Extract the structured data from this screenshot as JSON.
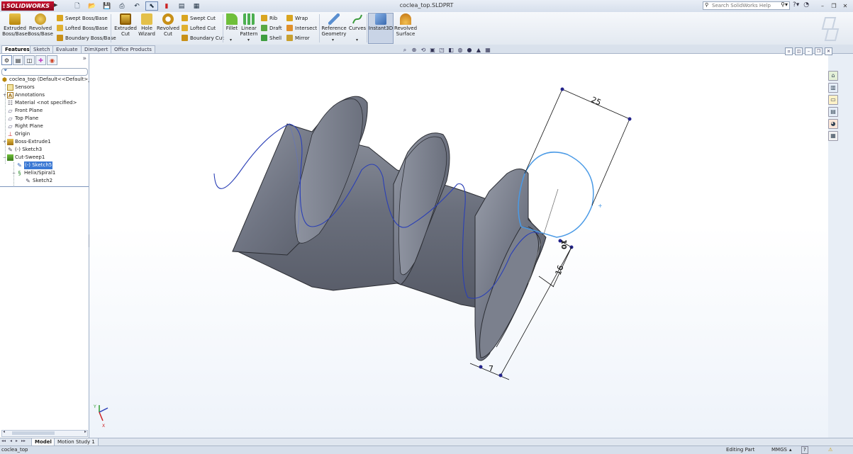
{
  "app": {
    "logo_text": "SOLIDWORKS",
    "doc_title": "coclea_top.SLDPRT"
  },
  "search": {
    "placeholder": "Search SolidWorks Help"
  },
  "ribbon": {
    "extruded_boss": "Extruded\nBoss/Base",
    "revolved_boss": "Revolved\nBoss/Base",
    "swept_boss": "Swept Boss/Base",
    "lofted_boss": "Lofted Boss/Base",
    "boundary_boss": "Boundary Boss/Base",
    "extruded_cut": "Extruded\nCut",
    "hole_wizard": "Hole\nWizard",
    "revolved_cut": "Revolved\nCut",
    "swept_cut": "Swept Cut",
    "lofted_cut": "Lofted Cut",
    "boundary_cut": "Boundary Cut",
    "fillet": "Fillet",
    "linear_pattern": "Linear\nPattern",
    "rib": "Rib",
    "draft": "Draft",
    "shell": "Shell",
    "wrap": "Wrap",
    "intersect": "Intersect",
    "mirror": "Mirror",
    "reference_geometry": "Reference\nGeometry",
    "curves": "Curves",
    "instant3d": "Instant3D",
    "revolved_surface": "Revolved\nSurface"
  },
  "tabs": [
    "Features",
    "Sketch",
    "Evaluate",
    "DimXpert",
    "Office Products"
  ],
  "tree": {
    "root": "coclea_top  (Default<<Default>_D",
    "sensors": "Sensors",
    "annotations": "Annotations",
    "material": "Material <not specified>",
    "front_plane": "Front Plane",
    "top_plane": "Top Plane",
    "right_plane": "Right Plane",
    "origin": "Origin",
    "boss_extrude": "Boss-Extrude1",
    "sketch3": "(-) Sketch3",
    "cut_sweep": "Cut-Sweep1",
    "sketch5": "(-) Sketch5",
    "helix": "Helix/Spiral1",
    "sketch2": "Sketch2"
  },
  "dimensions": {
    "d1": "25",
    "d2": "10",
    "d3": "16",
    "d4": "7"
  },
  "bottom_tabs": [
    "Model",
    "Motion Study 1"
  ],
  "status": {
    "doc": "coclea_top",
    "mode": "Editing Part",
    "units": "MMGS",
    "help": "?"
  },
  "colors": {
    "part_body": "#7d8290",
    "part_edge": "#2b2d33",
    "helix_curve": "#2a3fb6",
    "sketch_profile": "#4a9ae6",
    "dimension": "#111111",
    "accent": "#3a78d4"
  },
  "icons": {
    "new": "new-document-icon",
    "open": "open-folder-icon",
    "save": "save-icon",
    "print": "print-icon",
    "undo": "undo-icon",
    "select": "select-arrow-icon",
    "rebuild": "rebuild-traffic-light-icon",
    "options": "options-icon"
  }
}
